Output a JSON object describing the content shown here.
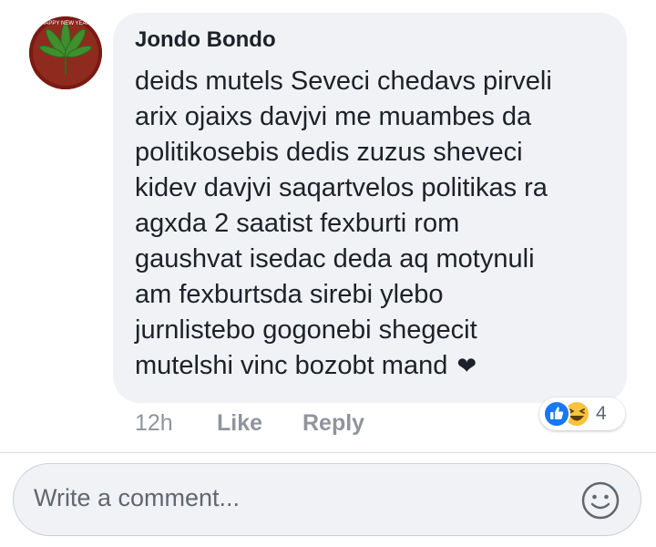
{
  "comment": {
    "author": "Jondo Bondo",
    "lines": [
      "deids mutels Seveci chedavs pirveli",
      "arix ojaixs davjvi me muambes da",
      "politikosebis dedis zuzus sheveci",
      "kidev davjvi saqartvelos politikas ra",
      "agxda 2 saatist fexburti rom",
      "gaushvat isedac deda aq motynuli",
      "am fexburtsda sirebi ylebo",
      "jurnlistebo gogonebi shegecit",
      "mutelshi vinc bozobt mand"
    ],
    "heart": "❤",
    "avatar_text": "HAPPY NEW YEAR",
    "time": "12h",
    "like_label": "Like",
    "reply_label": "Reply",
    "reactions": {
      "icons": [
        "like-reaction-icon",
        "haha-reaction-icon"
      ],
      "count": "4"
    }
  },
  "composer": {
    "placeholder": "Write a comment..."
  },
  "colors": {
    "bubble": "#f1f2f5",
    "text": "#1d2129",
    "meta": "#90949c",
    "like_blue": "#1877f2",
    "haha_yellow": "#f7c23f"
  }
}
